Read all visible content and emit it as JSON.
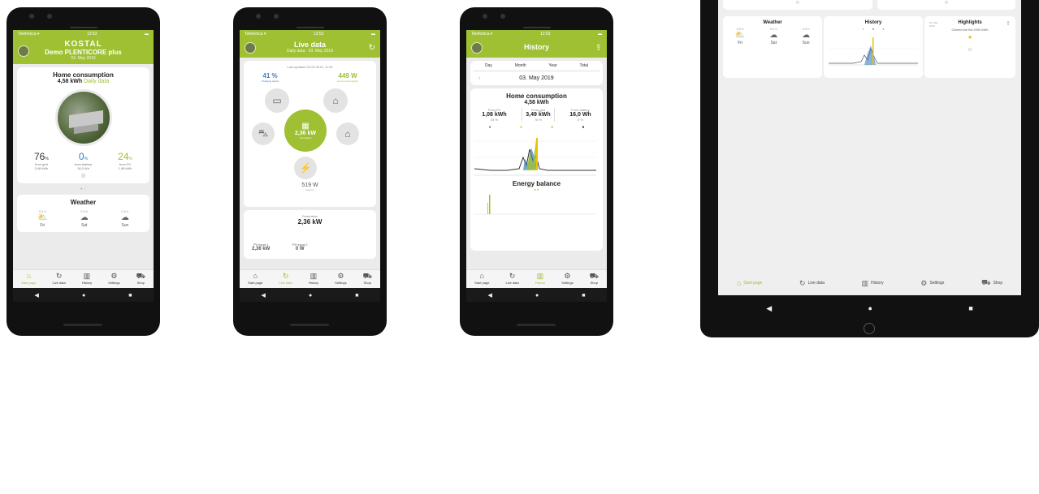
{
  "colors": {
    "accent": "#9ec032",
    "blue": "#3a7fc1",
    "bg": "#ebebeb"
  },
  "phone1": {
    "status_left": "Telefonica ▾",
    "status_time": "13:53",
    "logo": "KOSTAL",
    "title": "Demo PLENTICORE plus",
    "date": "03. May 2019",
    "home_card": {
      "title": "Home consumption",
      "value": "4,58 kWh",
      "suffix": "Daily data",
      "stats": [
        {
          "value": "76",
          "unit": "%",
          "label": "from grid",
          "sub": "3,48 kWh"
        },
        {
          "value": "0",
          "unit": "%",
          "label": "from battery",
          "sub": "16,0 Wh"
        },
        {
          "value": "24",
          "unit": "%",
          "label": "from PV",
          "sub": "1,08 kWh"
        }
      ]
    },
    "weather_card": {
      "title": "Weather",
      "days": [
        {
          "temp": "0.0 h",
          "icon": "partly-cloudy-icon",
          "glyph": "⛅",
          "day": "Fri"
        },
        {
          "temp": "0.0 h",
          "icon": "rain-cloud-icon",
          "glyph": "☁",
          "day": "Sat"
        },
        {
          "temp": "0.0 h",
          "icon": "rain-cloud-icon",
          "glyph": "☁",
          "day": "Sun"
        }
      ]
    },
    "tabs": [
      "Start page",
      "Live data",
      "History",
      "Settings",
      "Shop"
    ]
  },
  "phone2": {
    "status_left": "Telefonica ▾",
    "status_time": "13:53",
    "title": "Live data",
    "date": "Daily data · 03. May 2019",
    "updated": "Last updated 03.05.2019, 11:09",
    "battery_pct": "41 %",
    "battery_label": "Charging status",
    "home_w": "449 W",
    "home_label": "Home consumption",
    "pv_kw": "2,36 kW",
    "pv_label": "Generation",
    "grid_w": "519 W",
    "grid_label": "Feed-in",
    "gen_title": "Generation",
    "gen_value": "2,36 kW",
    "pv1_label": "PV input 1",
    "pv1_value": "2,36 kW",
    "pv2_label": "PV input 2",
    "pv2_value": "0 W",
    "tabs": [
      "Start page",
      "Live data",
      "History",
      "Settings",
      "Shop"
    ]
  },
  "phone3": {
    "status_left": "Telefonica ▾",
    "status_time": "13:53",
    "title": "History",
    "segments": [
      "Day",
      "Month",
      "Year",
      "Total"
    ],
    "date": "03. May 2019",
    "card_title": "Home consumption",
    "card_value": "4,58 kWh",
    "cols": [
      {
        "label": "From PV",
        "value": "1,08 kWh",
        "pct": "24 %"
      },
      {
        "label": "From grid",
        "value": "3,49 kWh",
        "pct": "76 %"
      },
      {
        "label": "From battery",
        "value": "16,0 Wh",
        "pct": "0 %"
      }
    ],
    "balance_title": "Energy balance",
    "tabs": [
      "Start page",
      "Live data",
      "History",
      "Settings",
      "Shop"
    ]
  },
  "tablet": {
    "weather_title": "Weather",
    "weather_days": [
      {
        "temp": "0.0 h",
        "day": "Fri"
      },
      {
        "temp": "0.0 h",
        "day": "Sat"
      },
      {
        "temp": "0.0 h",
        "day": "Sun"
      }
    ],
    "history_title": "History",
    "highlights_date": "03. May 2019",
    "highlights_title": "Highlights",
    "highlights_text": "Gained the fist 2000 kWh",
    "tabs": [
      "Start page",
      "Live data",
      "History",
      "Settings",
      "Shop"
    ]
  },
  "system_nav": [
    "◀",
    "●",
    "■"
  ]
}
